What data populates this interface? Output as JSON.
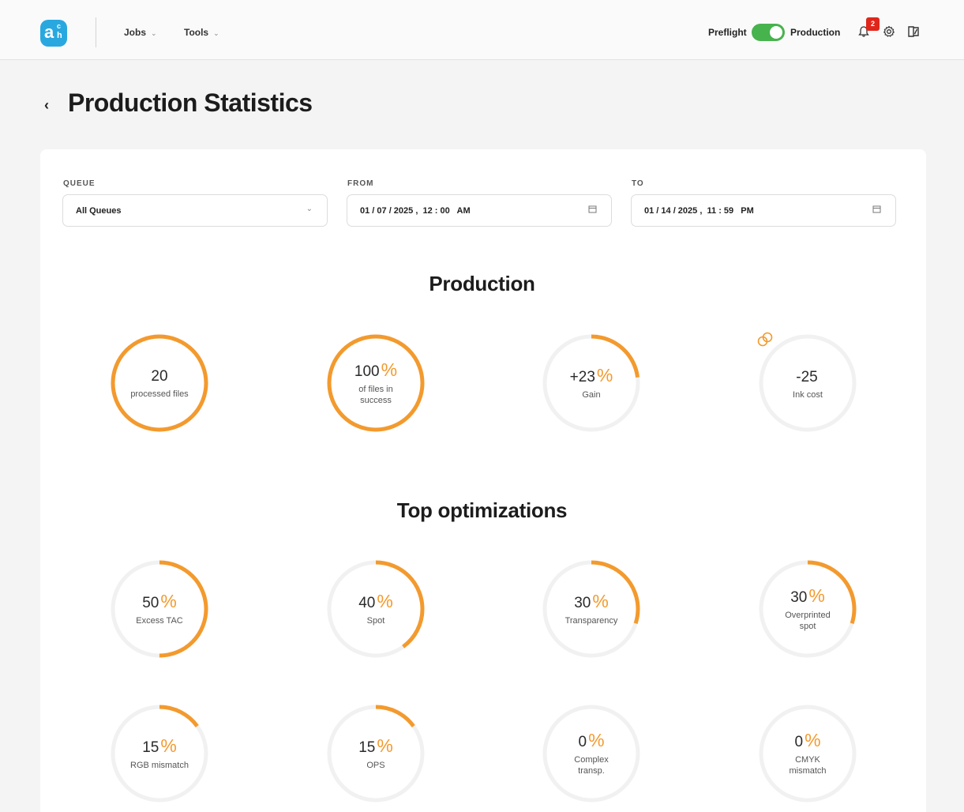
{
  "header": {
    "logo": {
      "a": "a",
      "c": "c",
      "h": "h"
    },
    "menu": [
      {
        "label": "Jobs",
        "chevron": "⌄"
      },
      {
        "label": "Tools",
        "chevron": "⌄"
      }
    ],
    "mode_left": "Preflight",
    "mode_right": "Production",
    "mode_toggle_on": true,
    "notifications_count": "2",
    "icons": [
      "bell-icon",
      "gear-icon",
      "sidebar-toggle-icon"
    ]
  },
  "page": {
    "back_icon": "‹",
    "title": "Production Statistics"
  },
  "filters": {
    "queue": {
      "label": "QUEUE",
      "value": "All Queues",
      "chevron": "⌄"
    },
    "from": {
      "label": "FROM",
      "value": "01 / 07 / 2025 ,  12 : 00   AM",
      "icon": "calendar-icon"
    },
    "to": {
      "label": "TO",
      "value": "01 / 14 / 2025 ,  11 : 59   PM",
      "icon": "calendar-icon"
    }
  },
  "colors": {
    "accent": "#f39a2e",
    "track": "#f1f1f1",
    "toggle": "#47b34d",
    "badge": "#e0261b"
  },
  "production": {
    "title": "Production",
    "gauges": [
      {
        "value": "20",
        "unit": "",
        "label": "processed files",
        "progress": 1.0
      },
      {
        "value": "100",
        "unit": "%",
        "label": "of files in success",
        "progress": 1.0
      },
      {
        "value": "+23",
        "unit": "%",
        "label": "Gain",
        "progress": 0.23
      },
      {
        "value": "-25",
        "unit": "",
        "unit_icon": "coins-icon",
        "label": "Ink cost",
        "progress": 0
      }
    ]
  },
  "optimizations": {
    "title": "Top optimizations",
    "gauges": [
      {
        "value": "50",
        "unit": "%",
        "label": "Excess TAC",
        "progress": 0.5
      },
      {
        "value": "40",
        "unit": "%",
        "label": "Spot",
        "progress": 0.4
      },
      {
        "value": "30",
        "unit": "%",
        "label": "Transparency",
        "progress": 0.3
      },
      {
        "value": "30",
        "unit": "%",
        "label": "Overprinted spot",
        "progress": 0.3
      },
      {
        "value": "15",
        "unit": "%",
        "label": "RGB mismatch",
        "progress": 0.15
      },
      {
        "value": "15",
        "unit": "%",
        "label": "OPS",
        "progress": 0.15
      },
      {
        "value": "0",
        "unit": "%",
        "label": "Complex transp.",
        "progress": 0
      },
      {
        "value": "0",
        "unit": "%",
        "label": "CMYK mismatch",
        "progress": 0
      }
    ]
  }
}
